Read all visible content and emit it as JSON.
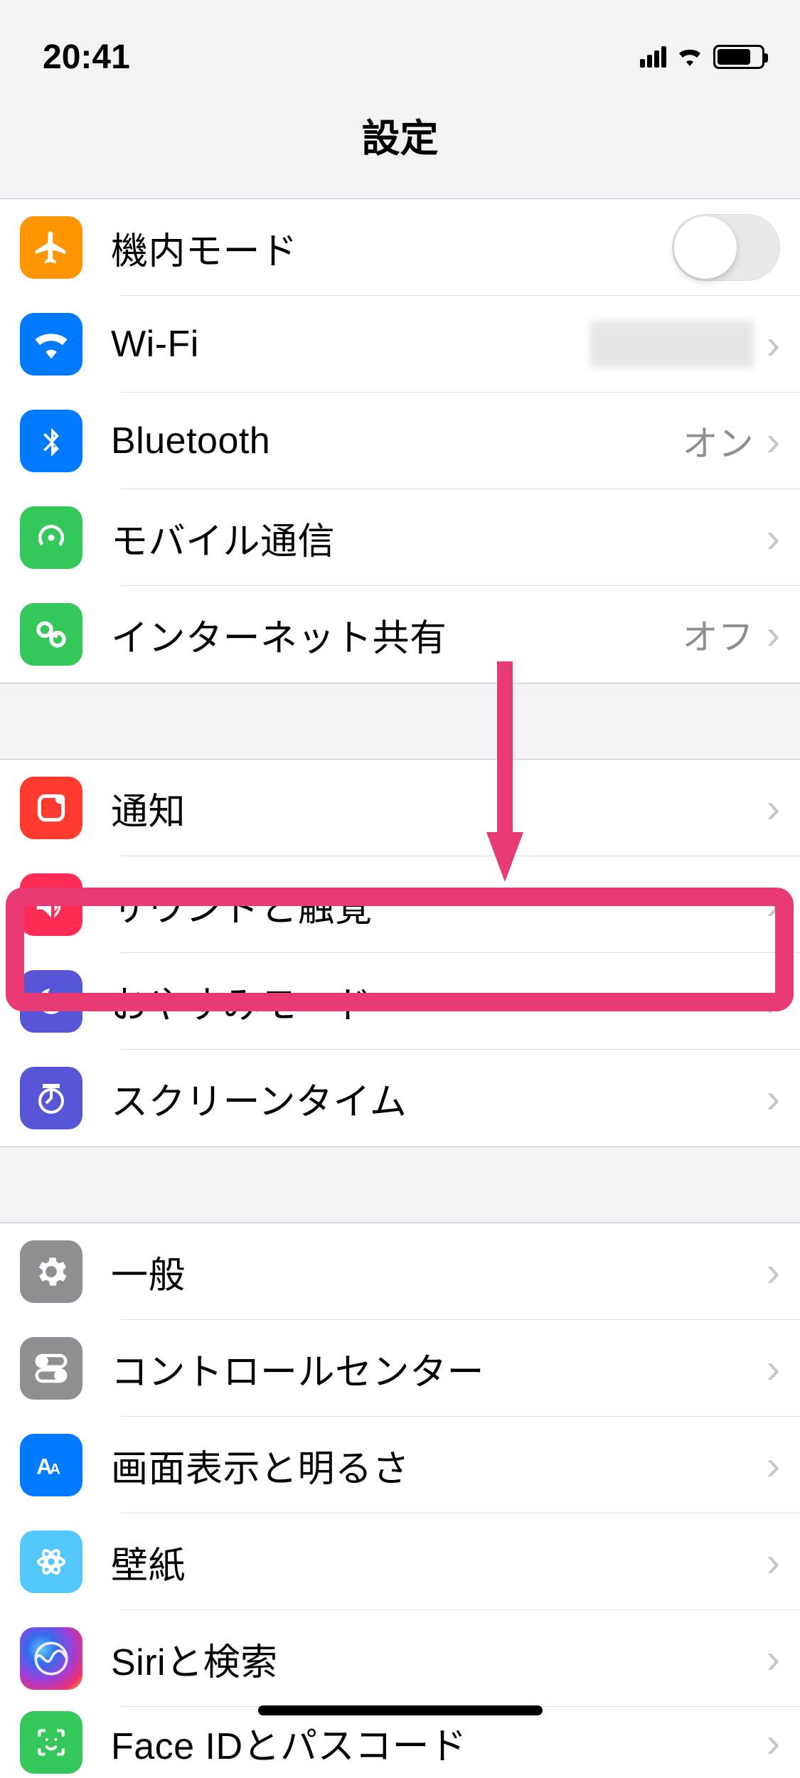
{
  "status": {
    "time": "20:41"
  },
  "title": "設定",
  "groups": [
    {
      "rows": [
        {
          "id": "airplane",
          "label": "機内モード",
          "icon": "airplane-icon",
          "color": "#ff9500",
          "type": "toggle",
          "toggle": false
        },
        {
          "id": "wifi",
          "label": "Wi-Fi",
          "icon": "wifi-icon",
          "color": "#007aff",
          "type": "link",
          "value_blurred": true
        },
        {
          "id": "bluetooth",
          "label": "Bluetooth",
          "icon": "bluetooth-icon",
          "color": "#007aff",
          "type": "link",
          "value": "オン"
        },
        {
          "id": "cellular",
          "label": "モバイル通信",
          "icon": "cellular-icon",
          "color": "#34c759",
          "type": "link"
        },
        {
          "id": "hotspot",
          "label": "インターネット共有",
          "icon": "hotspot-icon",
          "color": "#34c759",
          "type": "link",
          "value": "オフ"
        }
      ]
    },
    {
      "rows": [
        {
          "id": "notifications",
          "label": "通知",
          "icon": "notifications-icon",
          "color": "#ff3b30",
          "type": "link"
        },
        {
          "id": "sounds",
          "label": "サウンドと触覚",
          "icon": "sounds-icon",
          "color": "#ff3b30",
          "type": "link"
        },
        {
          "id": "dnd",
          "label": "おやすみモード",
          "icon": "dnd-icon",
          "color": "#5856d6",
          "type": "link",
          "highlighted": true
        },
        {
          "id": "screentime",
          "label": "スクリーンタイム",
          "icon": "screentime-icon",
          "color": "#5856d6",
          "type": "link"
        }
      ]
    },
    {
      "rows": [
        {
          "id": "general",
          "label": "一般",
          "icon": "general-icon",
          "color": "#8e8e93",
          "type": "link"
        },
        {
          "id": "controlcenter",
          "label": "コントロールセンター",
          "icon": "controlcenter-icon",
          "color": "#8e8e93",
          "type": "link"
        },
        {
          "id": "display",
          "label": "画面表示と明るさ",
          "icon": "display-icon",
          "color": "#007aff",
          "type": "link"
        },
        {
          "id": "wallpaper",
          "label": "壁紙",
          "icon": "wallpaper-icon",
          "color": "#54c7fc",
          "type": "link"
        },
        {
          "id": "siri",
          "label": "Siriと検索",
          "icon": "siri-icon",
          "color": "siri",
          "type": "link"
        },
        {
          "id": "faceid",
          "label": "Face IDとパスコード",
          "icon": "faceid-icon",
          "color": "#34c759",
          "type": "link"
        }
      ]
    }
  ],
  "annotation": {
    "highlight_row": "dnd",
    "color": "#e83b74"
  }
}
